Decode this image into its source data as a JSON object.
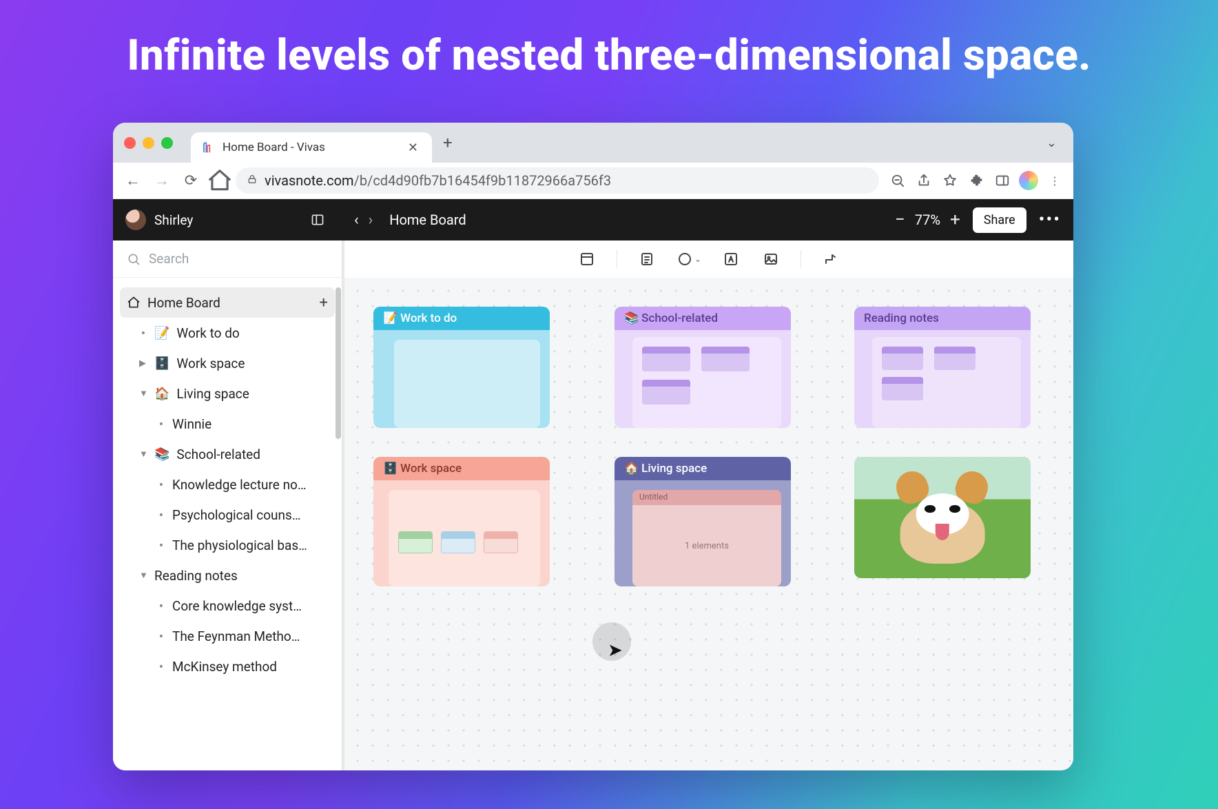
{
  "headline": "Infinite levels of nested three-dimensional space.",
  "browser": {
    "tab_title": "Home Board - Vivas",
    "url_host": "vivasnote.com",
    "url_path": "/b/cd4d90fb7b16454f9b11872966a756f3"
  },
  "app": {
    "user_name": "Shirley",
    "breadcrumb": "Home Board",
    "zoom": "77%",
    "share_label": "Share"
  },
  "search": {
    "placeholder": "Search"
  },
  "tree": {
    "root": {
      "label": "Home Board"
    },
    "items": [
      {
        "emoji": "📝",
        "label": "Work to do",
        "kind": "leaf"
      },
      {
        "emoji": "🗄️",
        "label": "Work space",
        "kind": "collapsed"
      },
      {
        "emoji": "🏠",
        "label": "Living space",
        "kind": "expanded",
        "children": [
          {
            "label": "Winnie"
          }
        ]
      },
      {
        "emoji": "📚",
        "label": "School-related",
        "kind": "expanded",
        "children": [
          {
            "label": "Knowledge lecture notes"
          },
          {
            "label": "Psychological counseli..."
          },
          {
            "label": "The physiological basis..."
          }
        ]
      },
      {
        "emoji": "",
        "label": "Reading notes",
        "kind": "expanded",
        "children": [
          {
            "label": "Core knowledge syste..."
          },
          {
            "label": "The Feynman Method ..."
          },
          {
            "label": "McKinsey method"
          }
        ]
      }
    ]
  },
  "cards": {
    "work_to_do": {
      "emoji": "📝",
      "title": "Work to do"
    },
    "school": {
      "emoji": "📚",
      "title": "School-related"
    },
    "reading": {
      "title": "Reading notes"
    },
    "work_space": {
      "emoji": "🗄️",
      "title": "Work space"
    },
    "living": {
      "emoji": "🏠",
      "title": "Living space",
      "inner_title": "Untitled",
      "inner_sub": "1 elements"
    }
  }
}
